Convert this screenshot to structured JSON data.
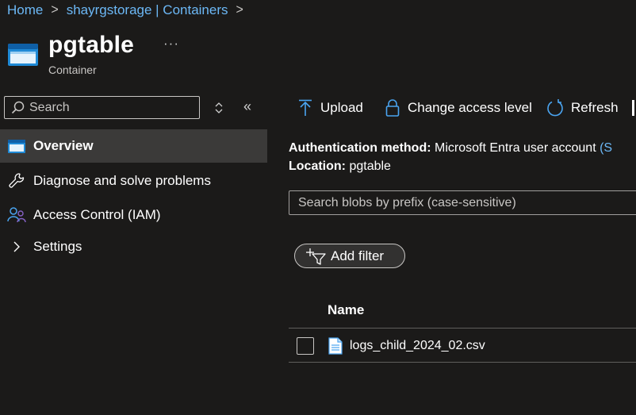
{
  "breadcrumb": {
    "home": "Home",
    "storage": "shayrgstorage | Containers"
  },
  "header": {
    "title": "pgtable",
    "more": "···",
    "subtitle": "Container"
  },
  "sidebar": {
    "search_placeholder": "Search",
    "items": [
      {
        "label": "Overview",
        "icon": "container-icon",
        "selected": true
      },
      {
        "label": "Diagnose and solve problems",
        "icon": "wrench-icon"
      },
      {
        "label": "Access Control (IAM)",
        "icon": "people-icon"
      },
      {
        "label": "Settings",
        "icon": "chevron-right-icon"
      }
    ]
  },
  "toolbar": {
    "upload": "Upload",
    "change_access": "Change access level",
    "refresh": "Refresh"
  },
  "info": {
    "auth_key": "Authentication method:",
    "auth_value": "Microsoft Entra user account",
    "auth_link": "(S",
    "location_key": "Location:",
    "location_value": "pgtable"
  },
  "blob_search": {
    "placeholder": "Search blobs by prefix (case-sensitive)"
  },
  "filter": {
    "add_label": "Add filter"
  },
  "table": {
    "columns": [
      "Name"
    ],
    "rows": [
      {
        "name": "logs_child_2024_02.csv"
      }
    ]
  },
  "colors": {
    "background": "#1b1a19",
    "link": "#6cb8f6",
    "selected": "#3b3a39",
    "accent": "#0078d4"
  }
}
